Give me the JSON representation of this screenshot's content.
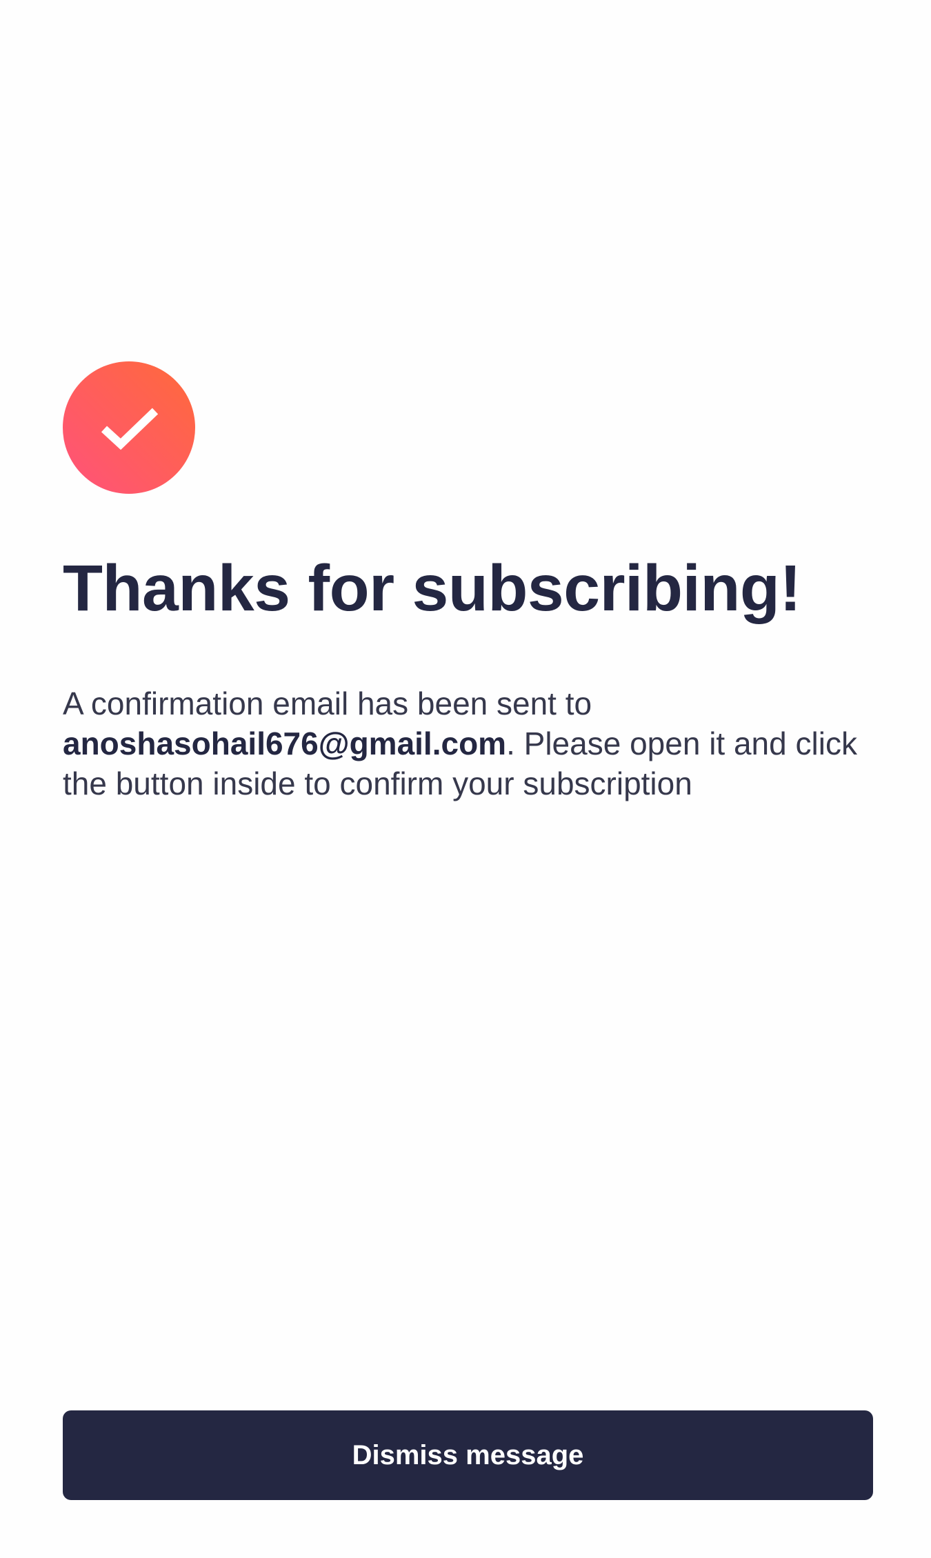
{
  "confirmation": {
    "icon": "checkmark-icon",
    "accent_gradient": [
      "#ff6a3a",
      "#ff527b"
    ],
    "title": "Thanks for subscribing!",
    "message_before_email": "A confirmation email has been sent to ",
    "email": "anoshasohail676@gmail.com",
    "message_after_email": ". Please open it and click the button inside to confirm your subscription",
    "dismiss_label": "Dismiss message"
  },
  "colors": {
    "primary": "#242742",
    "background": "#fefefe"
  }
}
